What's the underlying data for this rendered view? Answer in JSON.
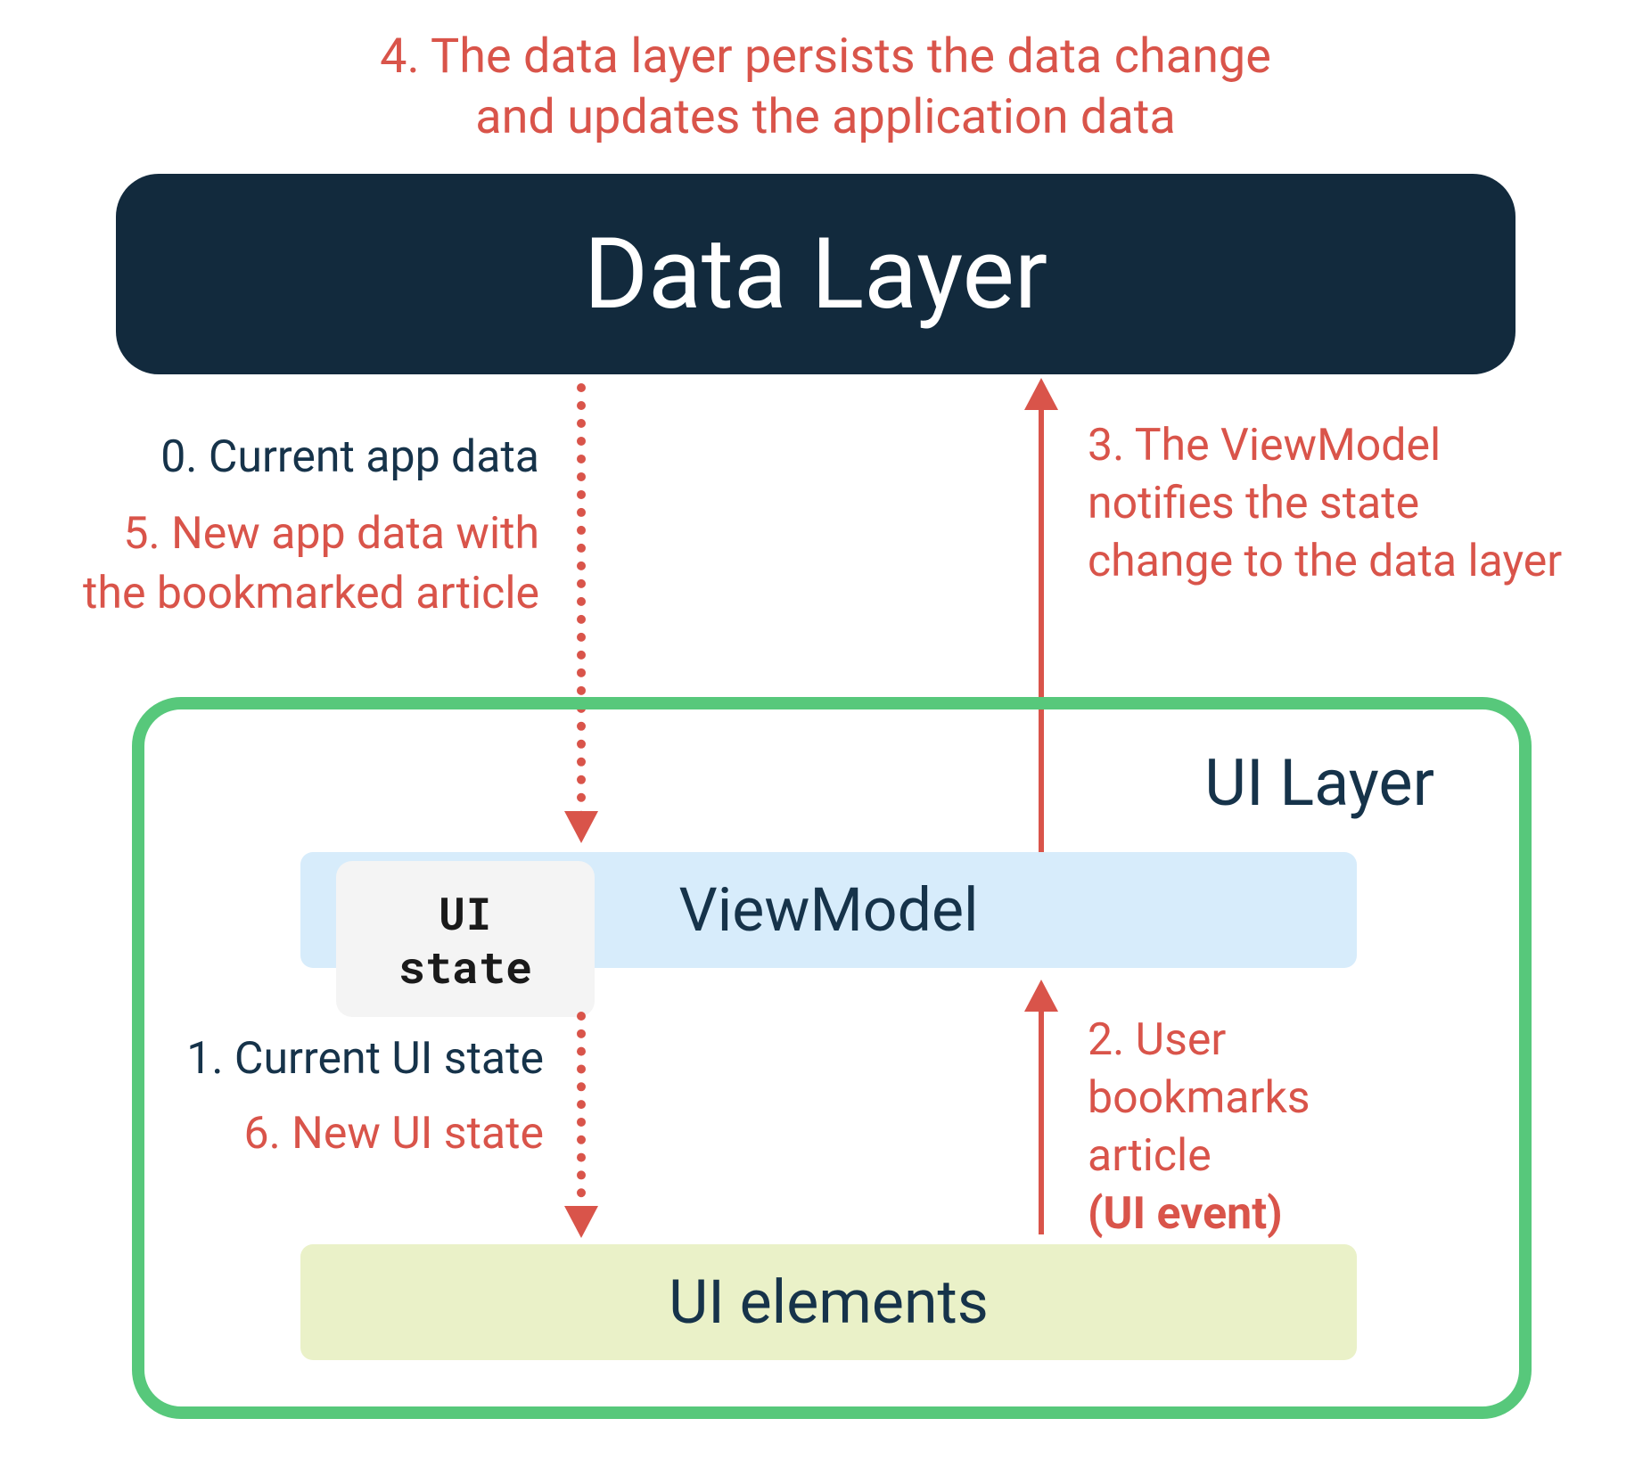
{
  "boxes": {
    "data_layer": "Data Layer",
    "ui_layer": "UI Layer",
    "viewmodel": "ViewModel",
    "ui_state": "UI\nstate",
    "ui_elements": "UI elements"
  },
  "steps": {
    "s0": "0. Current app data",
    "s1": "1. Current UI state",
    "s2_a": "2. User",
    "s2_b": "bookmarks",
    "s2_c": "article",
    "s2_d": "(UI event)",
    "s3": "3. The ViewModel notifies the state change to the data layer",
    "s4_a": "4. The data layer persists the data change",
    "s4_b": "and updates the application data",
    "s5": "5. New app data with the bookmarked article",
    "s6": "6. New UI state"
  },
  "colors": {
    "red": "#d9544a",
    "navy": "#122a3d",
    "green": "#57c87b",
    "vm_bg": "#d7ecfb",
    "el_bg": "#eaf1c8"
  }
}
